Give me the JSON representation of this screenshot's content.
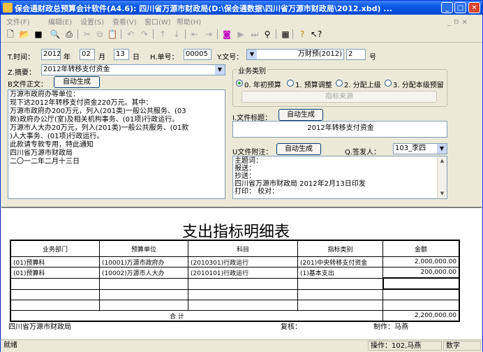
{
  "window": {
    "title": "保会通财政总预算会计软件(A4.6): 四川省万源市财政局(D:\\保会通数据\\四川省万源市财政局\\2012.xbd) ...",
    "ctrl_minimize": "_",
    "ctrl_maximize": "□",
    "ctrl_close": "✕"
  },
  "menu": {
    "items": [
      "文件(F)",
      "编辑(E)",
      "设置(S)",
      "查看(V)",
      "窗口(W)",
      "帮助(H)"
    ],
    "mdi_controls": "_ ㅁ ✕"
  },
  "toolbar": {
    "icons": [
      "new-icon",
      "open-icon",
      "save-icon",
      "print-preview-icon",
      "print-icon",
      "cut-icon",
      "copy-icon",
      "paste-icon",
      "undo-icon",
      "redo-icon",
      "up-icon",
      "down-icon",
      "first-icon",
      "last-icon",
      "record-icon",
      "next-icon",
      "end-icon",
      "binoculars-icon",
      "calculator-icon",
      "help-icon",
      "whats-this-icon"
    ]
  },
  "form": {
    "time_label": "T.时间：",
    "year": "2012",
    "year_unit": "年",
    "month": "02",
    "month_unit": "月",
    "day": "13",
    "day_unit": "日",
    "doc_no_label": "H.单号：",
    "doc_no": "00005",
    "wenhao_label": "Y.文号：",
    "wenhao_prefix": "万财预(2012)",
    "wenhao_no": "2",
    "wenhao_unit": "号",
    "summary_label": "Z.摘要：",
    "summary": "2012年转移支付资金",
    "body_label": "B文件正文：",
    "auto_gen": "自动生成",
    "body_lines": [
      "万源市政府办等单位：",
      "    现下达2012年转移支付资金220万元。其中：",
      "    万源市政府办200万元，列入(201类)一般公共服务、(03",
      "款)政府办公厅(室)及相关机构事务、(01项)行政运行。",
      "    万源市人大办20万元，列入(201类)一般公共服务、(01款",
      ")人大事务、(01项)行政运行。",
      "    此款请专款专用，特此通知",
      "    四川省万源市财政局",
      "    二〇一二年二月十三日"
    ],
    "biz_group": "业务类别",
    "radios": [
      "0. 年初预算",
      "1. 预算调整",
      "2. 分配上级",
      "3. 分配本级预留"
    ],
    "source_btn": "指标来源",
    "file_title_label": "I.文件标题：",
    "file_title": "2012年转移支付资金",
    "appendix_label": "U文件附注：",
    "signer_label": "Q.签发人：",
    "signer": "103_李四",
    "appendix_lines": [
      "主题词：",
      "报送：",
      "抄送：",
      "四川省万源市财政局                    2012年2月13日印发",
      "打印：                                          校对："
    ]
  },
  "report": {
    "title": "支出指标明细表",
    "headers": [
      "业务部门",
      "预算单位",
      "科目",
      "指标类别",
      "金额"
    ],
    "rows": [
      [
        "(01)预算科",
        "(10001)万源市政府办",
        "(2010301)行政运行",
        "(201)中央转移支付资金",
        "2,000,000.00"
      ],
      [
        "(01)预算科",
        "(10002)万源市人大办",
        "(2010101)行政运行",
        "(1)基本支出",
        "200,000.00"
      ],
      [
        "",
        "",
        "",
        "",
        ""
      ],
      [
        "",
        "",
        "",
        "",
        ""
      ],
      [
        "",
        "",
        "",
        "",
        ""
      ]
    ],
    "total_label": "合    计",
    "total": "2,200,000.00",
    "footer_org": "四川省万源市财政局",
    "footer_review": "复核：",
    "footer_maker": "制作：马燕"
  },
  "status": {
    "ready": "就绪",
    "operator": "操作：102,马燕",
    "mode": "数字"
  }
}
